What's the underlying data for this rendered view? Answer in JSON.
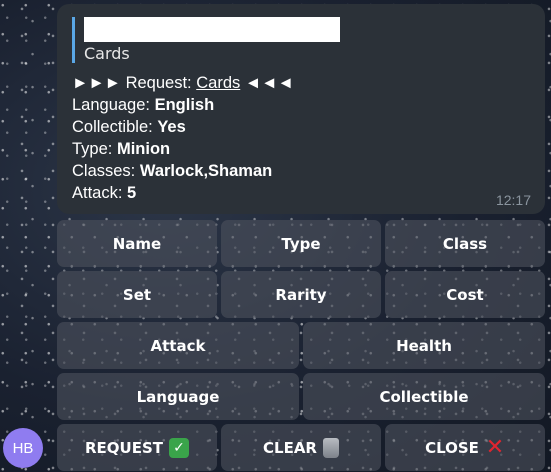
{
  "message": {
    "reply": {
      "text": "Cards"
    },
    "header": {
      "arrows_left": "►►►",
      "label": "Request:",
      "link": "Cards",
      "arrows_right": "◄◄◄"
    },
    "fields": [
      {
        "label": "Language:",
        "value": "English"
      },
      {
        "label": "Collectible:",
        "value": "Yes"
      },
      {
        "label": "Type:",
        "value": "Minion"
      },
      {
        "label": "Classes:",
        "value": "Warlock,Shaman"
      },
      {
        "label": "Attack:",
        "value": "5"
      }
    ],
    "time": "12:17"
  },
  "keyboard": {
    "row1": [
      "Name",
      "Type",
      "Class"
    ],
    "row2": [
      "Set",
      "Rarity",
      "Cost"
    ],
    "row3": [
      "Attack",
      "Health"
    ],
    "row4": [
      "Language",
      "Collectible"
    ],
    "row5": [
      {
        "label": "REQUEST",
        "icon": "check-mark-icon",
        "glyph": "✓"
      },
      {
        "label": "CLEAR",
        "icon": "trash-can-icon",
        "glyph": ""
      },
      {
        "label": "CLOSE",
        "icon": "cross-mark-icon",
        "glyph": "✕"
      }
    ]
  },
  "avatar": {
    "initials": "HB",
    "color": "#8f7cf0"
  },
  "colors": {
    "bubble": "#2b3138",
    "reply_bar": "#5aa7e6",
    "key_bg": "#4c505c",
    "check": "#3aa44a",
    "cross": "#e0252f"
  }
}
